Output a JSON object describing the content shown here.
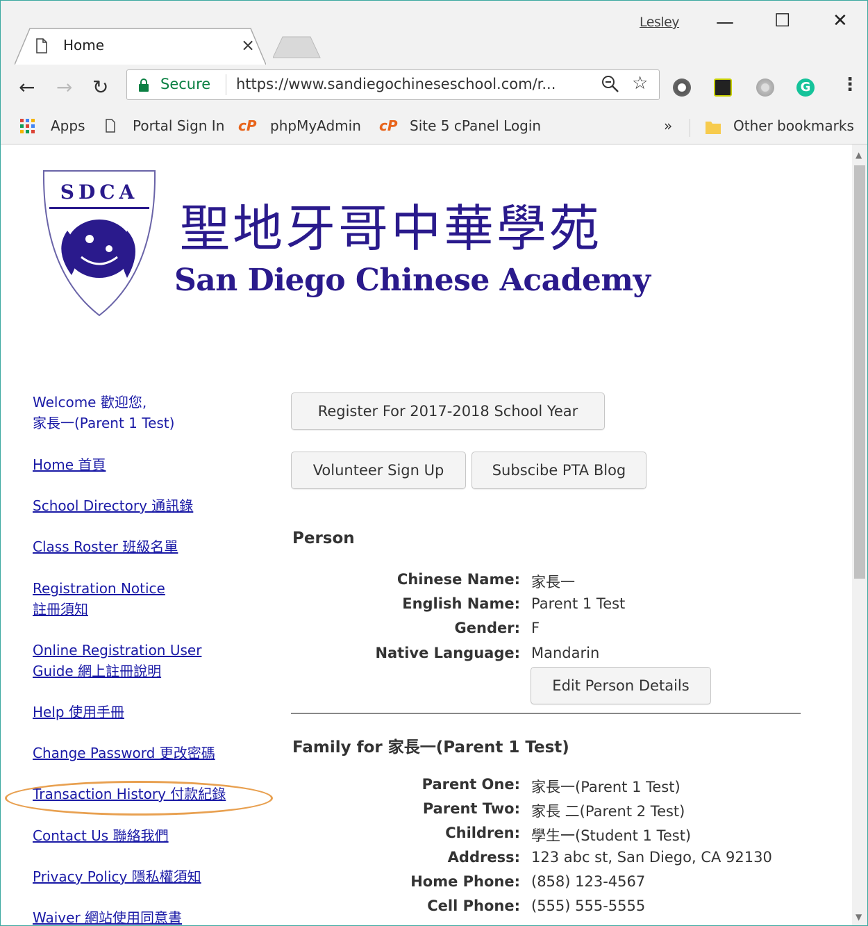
{
  "browser": {
    "tab_title": "Home",
    "profile_name": "Lesley",
    "secure_label": "Secure",
    "url": "https://www.sandiegochineseschool.com/r...",
    "bookmarks": {
      "apps": "Apps",
      "items": [
        "Portal Sign In",
        "phpMyAdmin",
        "Site 5 cPanel Login"
      ],
      "overflow": "»",
      "other": "Other bookmarks"
    }
  },
  "header": {
    "title_cn": "聖地牙哥中華學苑",
    "title_en": "San Diego Chinese Academy",
    "logo_text": "SDCA"
  },
  "sidebar": {
    "welcome_line1": "Welcome 歡迎您,",
    "welcome_line2": "家長一(Parent 1 Test)",
    "links": [
      [
        "Home 首頁"
      ],
      [
        "School Directory 通訊錄"
      ],
      [
        "Class Roster 班級名單"
      ],
      [
        "Registration Notice",
        "註冊須知"
      ],
      [
        "Online Registration User",
        "Guide 網上註冊說明"
      ],
      [
        "Help 使用手冊"
      ],
      [
        "Change Password 更改密碼"
      ],
      [
        "Transaction History 付款紀錄"
      ],
      [
        "Contact Us 聯絡我們 "
      ],
      [
        "Privacy Policy 隱私權須知 "
      ],
      [
        "Waiver 網站使用同意書 "
      ]
    ]
  },
  "main": {
    "register_button": "Register For 2017-2018 School Year",
    "volunteer_button": "Volunteer Sign Up",
    "pta_button": "Subscibe PTA Blog",
    "person": {
      "heading": "Person",
      "fields": [
        {
          "label": "Chinese Name:",
          "value": "家長一"
        },
        {
          "label": "English Name:",
          "value": "Parent 1 Test"
        },
        {
          "label": "Gender:",
          "value": "F"
        },
        {
          "label": "Native Language:",
          "value": "Mandarin"
        }
      ],
      "edit_button": "Edit Person Details"
    },
    "family": {
      "heading": "Family for 家長一(Parent 1 Test)",
      "fields": [
        {
          "label": "Parent One:",
          "value": "家長一(Parent 1 Test)"
        },
        {
          "label": "Parent Two:",
          "value": "家長 二(Parent 2 Test)"
        },
        {
          "label": "Children:",
          "value": "學生一(Student 1 Test)"
        },
        {
          "label": "Address:",
          "value": "123 abc st, San Diego, CA 92130"
        },
        {
          "label": "Home Phone:",
          "value": "(858) 123-4567"
        },
        {
          "label": "Cell Phone:",
          "value": "(555) 555-5555"
        }
      ]
    }
  },
  "colors": {
    "link": "#1a1aa6",
    "brand": "#2a1a8c",
    "highlight_oval": "#e8a050",
    "secure": "#0b8043"
  }
}
